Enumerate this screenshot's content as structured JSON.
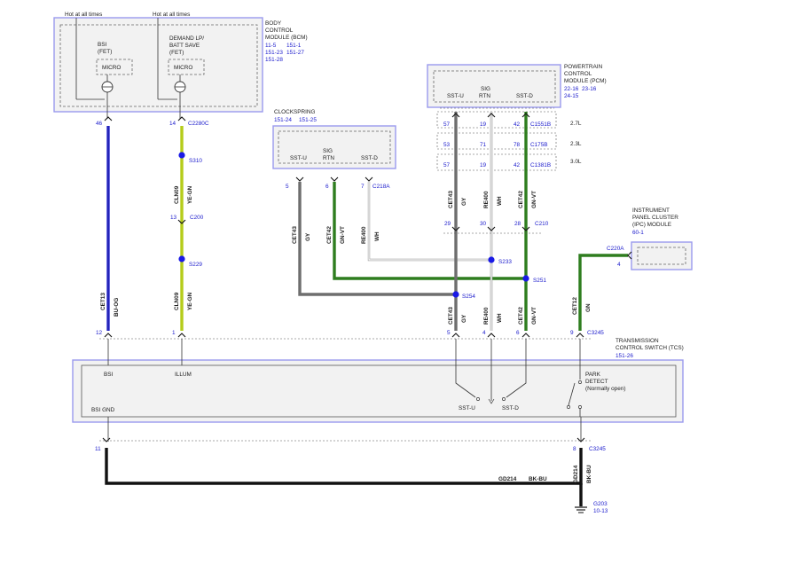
{
  "colors": {
    "blue_wire": "#2a2ad6",
    "yellow_green_wire": "#b5cc1a",
    "gray_wire": "#6e6e6e",
    "green_wire": "#2e7d1e",
    "black_wire": "#111111",
    "white_wire": "#cfcfcf",
    "splice": "#1a1ae6",
    "ref_text": "#1a1acc"
  },
  "bcm": {
    "title": [
      "BODY",
      "CONTROL",
      "MODULE (BCM)"
    ],
    "refs": [
      [
        "11-5",
        "151-1"
      ],
      [
        "151-23",
        "151-27"
      ],
      [
        "151-28"
      ]
    ],
    "hot1": "Hot at all times",
    "hot2": "Hot at all times",
    "bsi_label": [
      "BSI",
      "(FET)"
    ],
    "demand_label": [
      "DEMAND LP/",
      "BATT SAVE",
      "(FET)"
    ],
    "micro1": "MICRO",
    "micro2": "MICRO",
    "pin_bsi": "46",
    "pin_illum": "14",
    "connector": "C2280C"
  },
  "pcm": {
    "title": [
      "POWERTRAIN",
      "CONTROL",
      "MODULE (PCM)"
    ],
    "refs": [
      [
        "22-16",
        "23-16"
      ],
      [
        "24-15"
      ]
    ],
    "sst_u": "SST-U",
    "sig_rtn": [
      "SIG",
      "RTN"
    ],
    "sst_d": "SST-D",
    "rows": [
      {
        "pins": [
          "57",
          "19",
          "42"
        ],
        "connector": "C1551B",
        "engine": "2.7L"
      },
      {
        "pins": [
          "53",
          "71",
          "78"
        ],
        "connector": "C175B",
        "engine": "2.3L"
      },
      {
        "pins": [
          "57",
          "19",
          "42"
        ],
        "connector": "C1381B",
        "engine": "3.0L"
      }
    ]
  },
  "clockspring": {
    "title": "CLOCKSPRING",
    "refs": [
      "151-24",
      "151-25"
    ],
    "sst_u": "SST-U",
    "sig_rtn": [
      "SIG",
      "RTN"
    ],
    "sst_d": "SST-D",
    "pins": [
      "5",
      "6",
      "7"
    ],
    "connector": "C218A"
  },
  "ipc": {
    "title": [
      "INSTRUMENT",
      "PANEL CLUSTER",
      "(IPC) MODULE"
    ],
    "ref": "60-1",
    "connector": "C220A",
    "pin": "4"
  },
  "tcs": {
    "title": [
      "TRANSMISSION",
      "CONTROL SWITCH (TCS)"
    ],
    "ref": "151-26",
    "bsi": "BSI",
    "illum": "ILLUM",
    "bsi_gnd": "BSI GND",
    "sst_u": "SST-U",
    "sst_d": "SST-D",
    "park_detect": [
      "PARK",
      "DETECT",
      "(Normally open)"
    ],
    "top_connector": "C3245",
    "top_pins": [
      "12",
      "1",
      "5",
      "4",
      "6",
      "9"
    ],
    "bottom_connector": "C3245",
    "bottom_pins": [
      "11",
      "8"
    ]
  },
  "splices": [
    "S310",
    "S229",
    "S233",
    "S251",
    "S254"
  ],
  "inline_connector": {
    "name": "C200",
    "pin": "13"
  },
  "c210": {
    "name": "C210",
    "pins": [
      "29",
      "30",
      "28"
    ]
  },
  "wires": {
    "bsi": {
      "circuit": "CET13",
      "color": "BU-OG"
    },
    "illum_upper": {
      "circuit": "CLN09",
      "color": "YE-GN"
    },
    "illum_lower": {
      "circuit": "CLN09",
      "color": "YE-GN"
    },
    "gy_cs": {
      "circuit": "CET43",
      "color": "GY"
    },
    "gnvt_cs": {
      "circuit": "CET42",
      "color": "GN-VT"
    },
    "wh_cs": {
      "circuit": "RE400",
      "color": "WH"
    },
    "gy_pcm": {
      "circuit": "CET43",
      "color": "GY"
    },
    "wh_pcm": {
      "circuit": "RE400",
      "color": "WH"
    },
    "gnvt_pcm": {
      "circuit": "CET42",
      "color": "GN-VT"
    },
    "gy_tcs": {
      "circuit": "CET43",
      "color": "GY"
    },
    "wh_tcs": {
      "circuit": "RE400",
      "color": "WH"
    },
    "gnvt_tcs": {
      "circuit": "CET42",
      "color": "GN-VT"
    },
    "gn_ipc": {
      "circuit": "CET12",
      "color": "GN"
    },
    "ground_horiz": {
      "circuit": "GD214",
      "color": "BK-BU"
    },
    "ground_vert": {
      "circuit": "GD214",
      "color": "BK-BU"
    }
  },
  "ground": {
    "name": "G203",
    "ref": "10-13"
  }
}
